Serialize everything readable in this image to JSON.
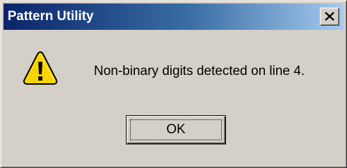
{
  "window": {
    "title": "Pattern Utility",
    "close_glyph": "X"
  },
  "message": {
    "icon": "warning-icon",
    "text": "Non-binary digits detected on line 4."
  },
  "buttons": {
    "ok_label": "OK"
  },
  "colors": {
    "titlebar_start": "#0a246a",
    "titlebar_end": "#a6caf0",
    "dialog_face": "#d4d0c8",
    "warning_fill": "#f7d400",
    "warning_outline": "#000000"
  }
}
